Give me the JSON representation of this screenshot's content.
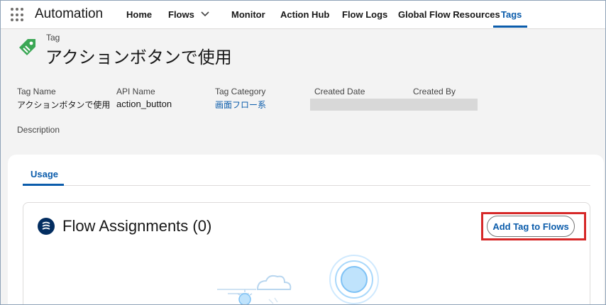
{
  "nav": {
    "app_name": "Automation",
    "items": [
      {
        "label": "Home"
      },
      {
        "label": "Flows"
      },
      {
        "label": "Monitor"
      },
      {
        "label": "Action Hub"
      },
      {
        "label": "Flow Logs"
      },
      {
        "label": "Global Flow Resources"
      },
      {
        "label": "Tags"
      }
    ],
    "active": "Tags"
  },
  "header": {
    "record_type": "Tag",
    "title": "アクションボタンで使用"
  },
  "fields": [
    {
      "label": "Tag Name",
      "value": "アクションボタンで使用"
    },
    {
      "label": "API Name",
      "value": "action_button"
    },
    {
      "label": "Tag Category",
      "value": "画面フロー系"
    },
    {
      "label": "Created Date",
      "value": ""
    },
    {
      "label": "Created By",
      "value": ""
    }
  ],
  "description_label": "Description",
  "tabs": {
    "usage": "Usage"
  },
  "assignments": {
    "title": "Flow Assignments (0)",
    "add_button": "Add Tag to Flows"
  },
  "colors": {
    "brand_blue": "#0b5cab",
    "tag_green": "#3ba755",
    "highlight_red": "#d62828"
  }
}
